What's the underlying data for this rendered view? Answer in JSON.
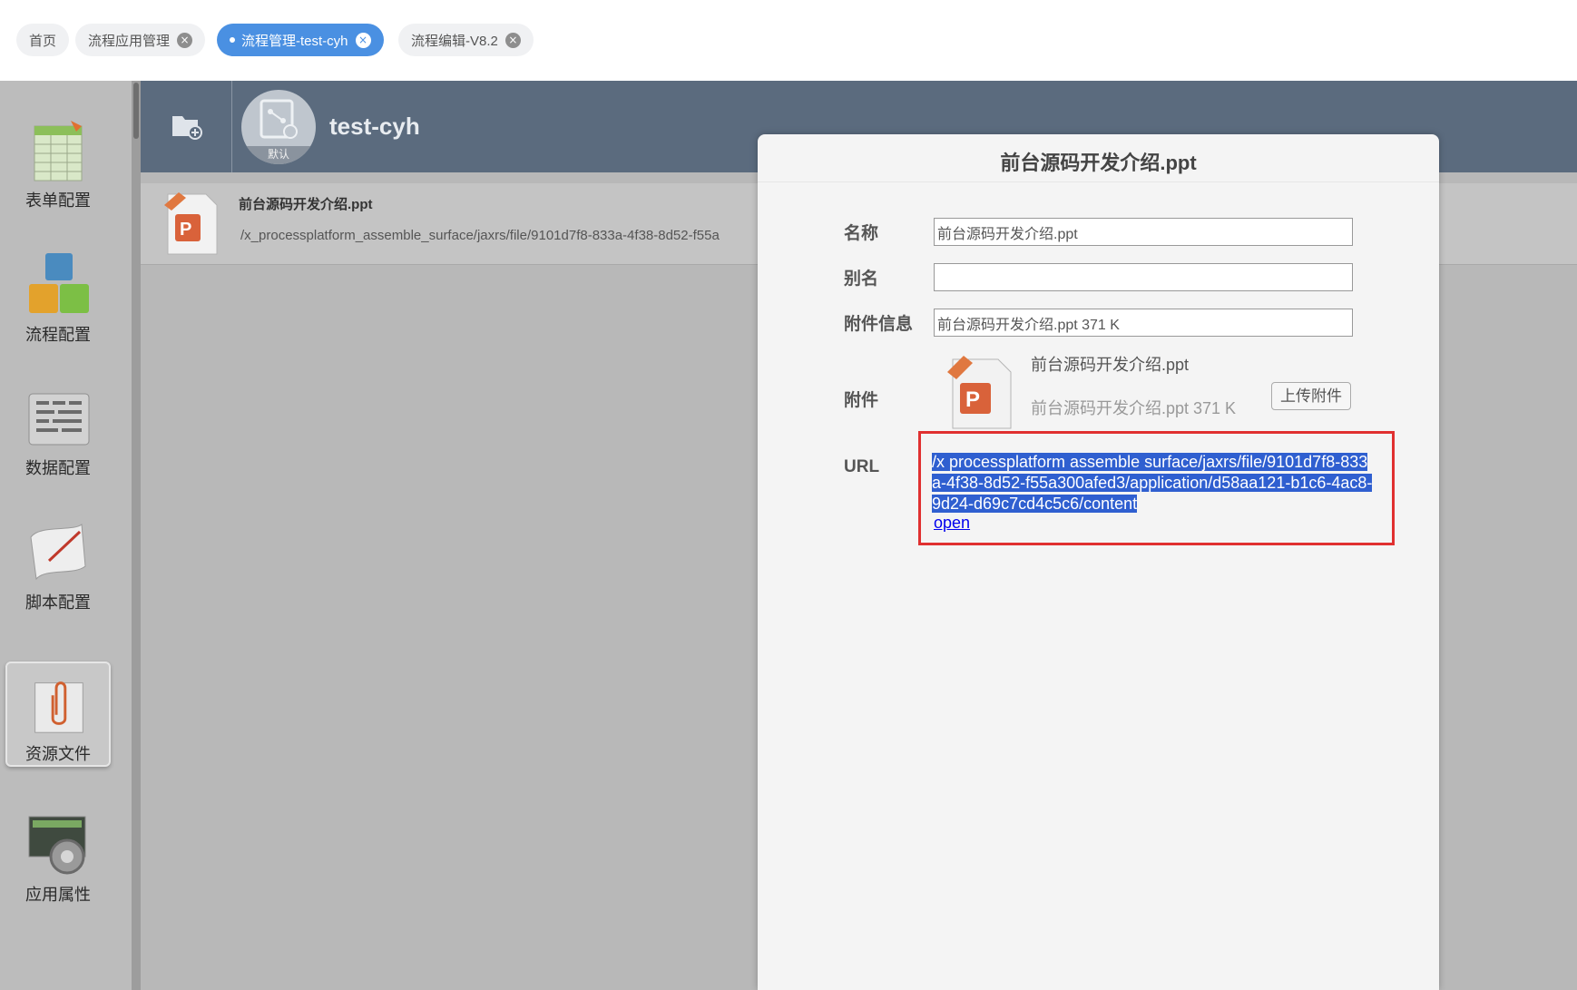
{
  "tabs": [
    {
      "label": "首页",
      "closable": false,
      "active": false
    },
    {
      "label": "流程应用管理",
      "closable": true,
      "active": false
    },
    {
      "label": "流程管理-test-cyh",
      "closable": true,
      "active": true
    },
    {
      "label": "流程编辑-V8.2",
      "closable": true,
      "active": false
    }
  ],
  "close_glyph": "×",
  "sidebar": {
    "items": [
      {
        "label": "表单配置",
        "icon": "form-config-icon"
      },
      {
        "label": "流程配置",
        "icon": "process-config-icon"
      },
      {
        "label": "数据配置",
        "icon": "data-config-icon"
      },
      {
        "label": "脚本配置",
        "icon": "script-config-icon"
      },
      {
        "label": "资源文件",
        "icon": "resource-file-icon",
        "selected": true
      },
      {
        "label": "应用属性",
        "icon": "app-property-icon"
      }
    ]
  },
  "header": {
    "app_name": "test-cyh",
    "app_badge": "默认"
  },
  "file_list": {
    "items": [
      {
        "name": "前台源码开发介绍.ppt",
        "path": "/x_processplatform_assemble_surface/jaxrs/file/9101d7f8-833a-4f38-8d52-f55a"
      }
    ]
  },
  "dialog": {
    "title": "前台源码开发介绍.ppt",
    "name_label": "名称",
    "name_value": "前台源码开发介绍.ppt",
    "alias_label": "别名",
    "alias_value": "",
    "attachment_info_label": "附件信息",
    "attachment_info_value": "前台源码开发介绍.ppt 371 K",
    "attachment_label": "附件",
    "attachment_name": "前台源码开发介绍.ppt",
    "attachment_size": "前台源码开发介绍.ppt 371 K",
    "upload_button": "上传附件",
    "url_label": "URL",
    "url_value": "/x processplatform assemble surface/jaxrs/file/9101d7f8-833a-4f38-8d52-f55a300afed3/application/d58aa121-b1c6-4ac8-9d24-d69c7cd4c5c6/content",
    "open_link": "open"
  },
  "colors": {
    "active_tab": "#4a90e2",
    "header_bg": "#5b6b7e",
    "highlight_box": "#e03030",
    "selection": "#2f5fd0"
  }
}
